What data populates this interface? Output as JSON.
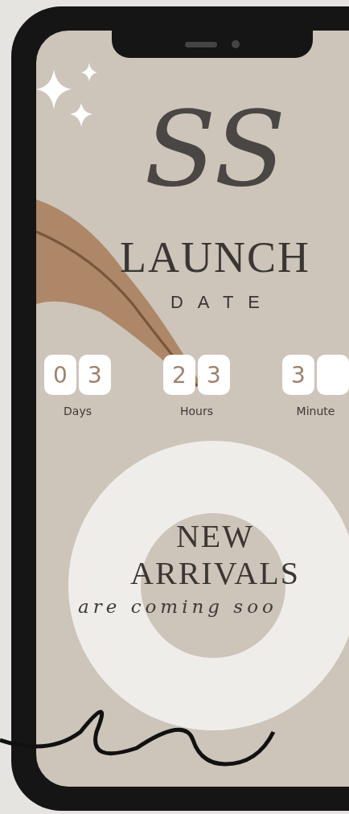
{
  "logo": {
    "text": "SS"
  },
  "headline": {
    "title": "LAUNCH",
    "subtitle": "DATE"
  },
  "countdown": [
    {
      "label": "Days",
      "digits": [
        "0",
        "3"
      ]
    },
    {
      "label": "Hours",
      "digits": [
        "2",
        "3"
      ]
    },
    {
      "label": "Minute",
      "digits": [
        "3"
      ]
    }
  ],
  "announcement": {
    "line_1": "NEW",
    "line_2": "ARRIVALS",
    "tagline": "are coming soo"
  }
}
